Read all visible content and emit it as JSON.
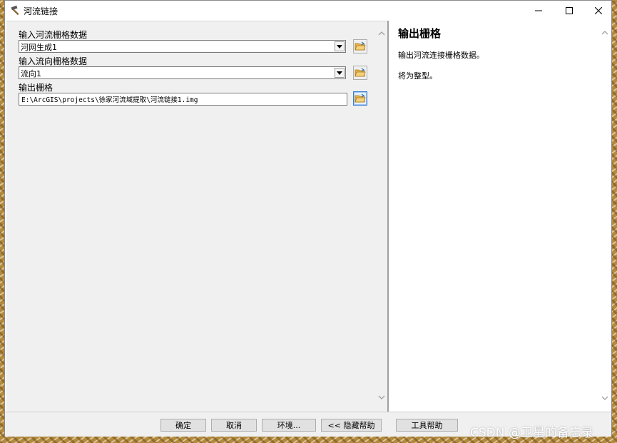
{
  "window": {
    "title": "河流链接",
    "title_icon": "hammer-icon"
  },
  "left": {
    "fields": [
      {
        "label": "输入河流栅格数据",
        "value": "河网生成1"
      },
      {
        "label": "输入流向栅格数据",
        "value": "流向1"
      },
      {
        "label": "输出栅格",
        "value": "E:\\ArcGIS\\projects\\徐家河流域提取\\河流链接1.img"
      }
    ]
  },
  "help": {
    "title": "输出栅格",
    "paragraphs": [
      "输出河流连接栅格数据。",
      "将为整型。"
    ]
  },
  "buttons": {
    "ok": "确定",
    "cancel": "取消",
    "env": "环境...",
    "hide_help": "<< 隐藏帮助",
    "tool_help": "工具帮助"
  },
  "watermark": "CSDN @卫星的备忘录",
  "colors": {
    "focus_blue": "#3a7bd5",
    "pane_bg": "#f0f0f0"
  }
}
